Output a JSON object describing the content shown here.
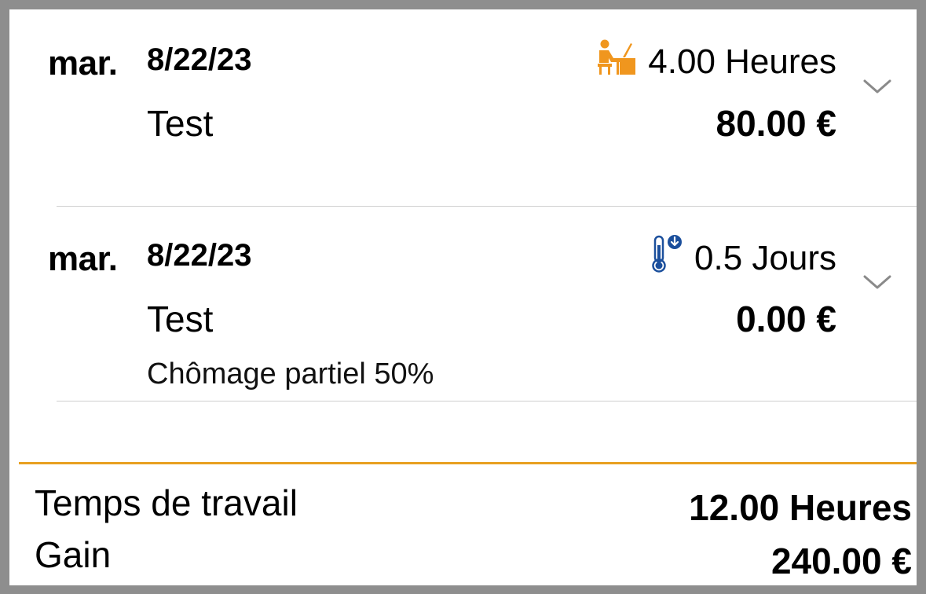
{
  "entries": [
    {
      "day": "mar.",
      "date": "8/22/23",
      "quantity": "4.00 Heures",
      "quantity_icon": "worker-at-desk-icon",
      "title": "Test",
      "amount": "80.00 €",
      "note": ""
    },
    {
      "day": "mar.",
      "date": "8/22/23",
      "quantity": "0.5 Jours",
      "quantity_icon": "thermometer-sick-icon",
      "title": "Test",
      "amount": "0.00 €",
      "note": "Chômage partiel 50%"
    }
  ],
  "summary": {
    "work_time_label": "Temps de travail",
    "work_time_value": "12.00 Heures",
    "earnings_label": "Gain",
    "earnings_value": "240.00 €"
  },
  "colors": {
    "accent": "#f0961e",
    "sick_icon": "#1b4f9c",
    "footer_border": "#e8a020",
    "frame": "#8e8e8e"
  }
}
